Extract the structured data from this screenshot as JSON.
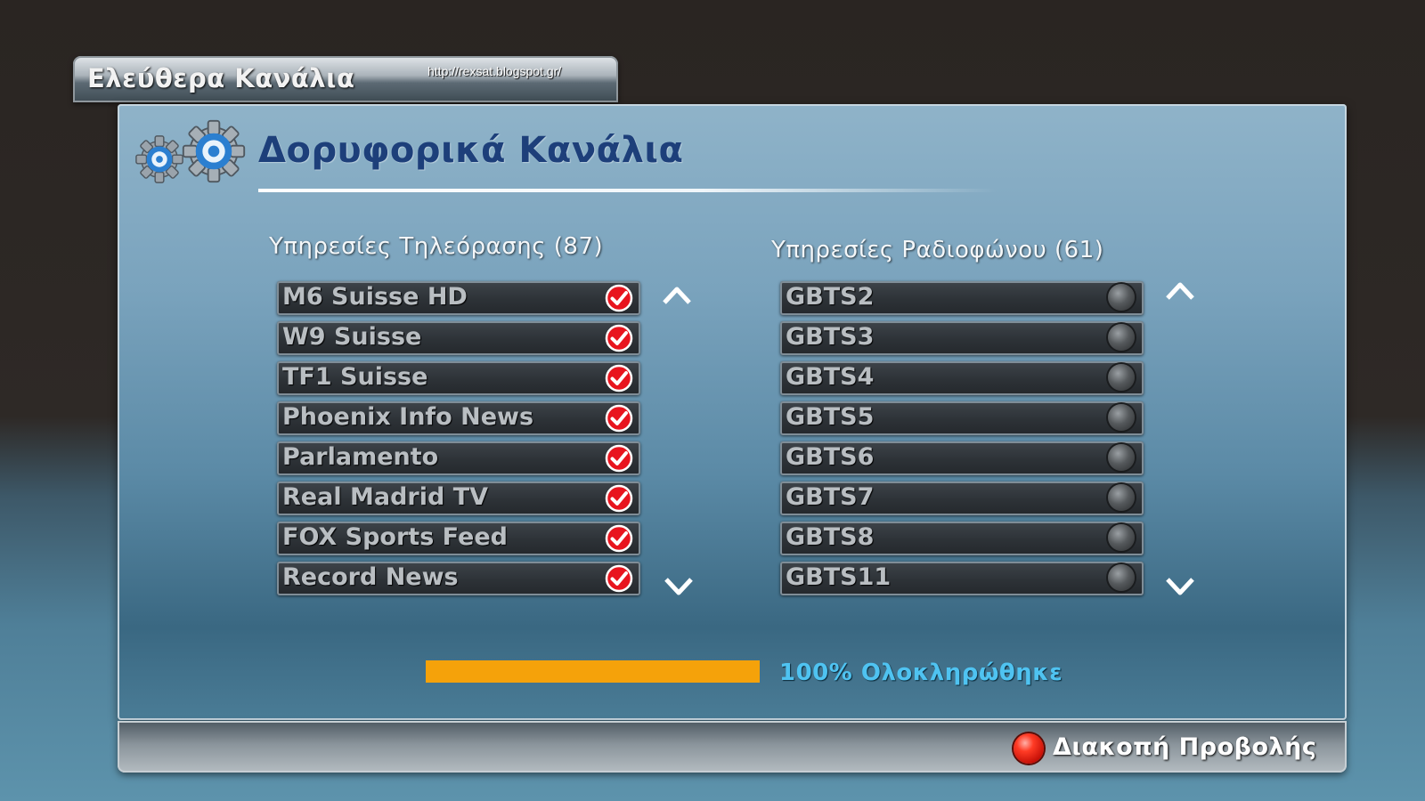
{
  "header": {
    "tab_title": "Ελεύθερα Κανάλια",
    "url": "http://rexsat.blogspot.gr/"
  },
  "panel": {
    "title": "Δορυφορικά Κανάλια"
  },
  "tv_services": {
    "heading": "Υπηρεσίες Τηλεόρασης (87)",
    "items": [
      {
        "label": "M6 Suisse HD",
        "selected": true
      },
      {
        "label": "W9 Suisse",
        "selected": true
      },
      {
        "label": "TF1 Suisse",
        "selected": true
      },
      {
        "label": "Phoenix Info News",
        "selected": true
      },
      {
        "label": "Parlamento",
        "selected": true
      },
      {
        "label": "Real Madrid TV",
        "selected": true
      },
      {
        "label": "FOX Sports Feed",
        "selected": true
      },
      {
        "label": "Record News",
        "selected": true
      }
    ]
  },
  "radio_services": {
    "heading": "Υπηρεσίες Ραδιοφώνου (61)",
    "items": [
      {
        "label": "GBTS2",
        "selected": false
      },
      {
        "label": "GBTS3",
        "selected": false
      },
      {
        "label": "GBTS4",
        "selected": false
      },
      {
        "label": "GBTS5",
        "selected": false
      },
      {
        "label": "GBTS6",
        "selected": false
      },
      {
        "label": "GBTS7",
        "selected": false
      },
      {
        "label": "GBTS8",
        "selected": false
      },
      {
        "label": "GBTS11",
        "selected": false
      }
    ]
  },
  "progress": {
    "percent": 100,
    "label": "100% Ολοκληρώθηκε"
  },
  "footer": {
    "stop_label": "Διακοπή Προβολής"
  },
  "colors": {
    "progress_fill": "#f5a20a",
    "title": "#1d3f7a",
    "progress_text": "#4fc3f1",
    "check_red": "#e8141e"
  }
}
